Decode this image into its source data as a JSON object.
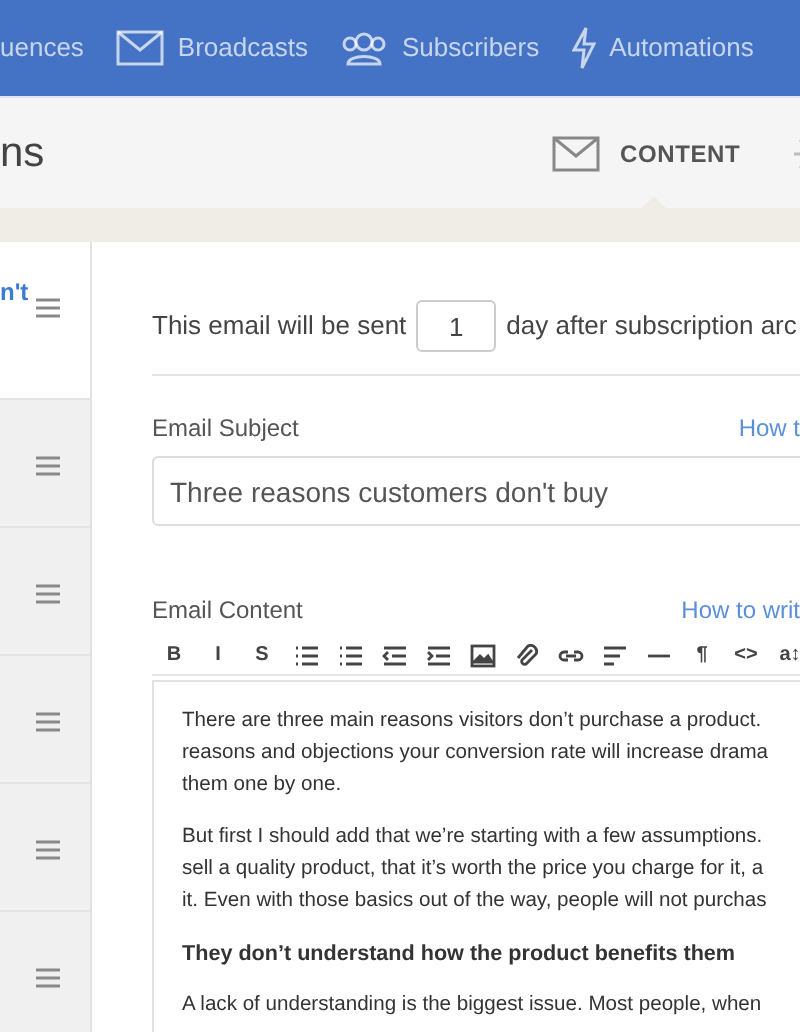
{
  "nav": [
    {
      "kind": "none",
      "label": "uences"
    },
    {
      "kind": "envelope",
      "label": "Broadcasts"
    },
    {
      "kind": "people",
      "label": "Subscribers"
    },
    {
      "kind": "bolt",
      "label": "Automations"
    }
  ],
  "header": {
    "title": "ns",
    "tabs": [
      {
        "kind": "envelope",
        "label": "CONTENT",
        "selected": true
      },
      {
        "kind": "gear",
        "selected": false
      }
    ]
  },
  "sidebar": {
    "items": [
      {
        "label": "n't",
        "selected": true
      },
      {
        "selected": false
      },
      {
        "selected": false
      },
      {
        "selected": false
      },
      {
        "selected": false
      },
      {
        "selected": false
      }
    ]
  },
  "schedule": {
    "before": "This email will be sent",
    "days": "1",
    "after": "day after subscription arc"
  },
  "subject": {
    "label": "Email Subject",
    "help": "How t",
    "value": "Three reasons customers don't buy"
  },
  "content": {
    "label": "Email Content",
    "help": "How to writ",
    "toolbar": [
      {
        "kind": "glyph",
        "label": "B"
      },
      {
        "kind": "glyph",
        "label": "I"
      },
      {
        "kind": "glyph",
        "label": "S"
      },
      {
        "kind": "bullet-list"
      },
      {
        "kind": "number-list"
      },
      {
        "kind": "outdent"
      },
      {
        "kind": "indent"
      },
      {
        "kind": "image"
      },
      {
        "kind": "paperclip"
      },
      {
        "kind": "link"
      },
      {
        "kind": "align"
      },
      {
        "kind": "rule"
      },
      {
        "kind": "glyph",
        "label": "¶"
      },
      {
        "kind": "glyph",
        "label": "<>"
      },
      {
        "kind": "glyph",
        "label": "a↕"
      }
    ],
    "blocks": [
      {
        "kind": "paragraph",
        "lines": [
          "There are three main reasons visitors don’t purchase a product.",
          "reasons and objections your conversion rate will increase drama",
          "them one by one."
        ]
      },
      {
        "kind": "paragraph",
        "lines": [
          "But first I should add that we’re starting with a few assumptions.",
          "sell a quality product, that it’s worth the price you charge for it, a",
          "it. Even with those basics out of the way, people will not purchas"
        ]
      },
      {
        "kind": "heading",
        "lines": [
          "They don’t understand how the product benefits them"
        ]
      },
      {
        "kind": "paragraph",
        "lines": [
          "A lack of understanding is the biggest issue. Most people, when"
        ]
      }
    ]
  }
}
